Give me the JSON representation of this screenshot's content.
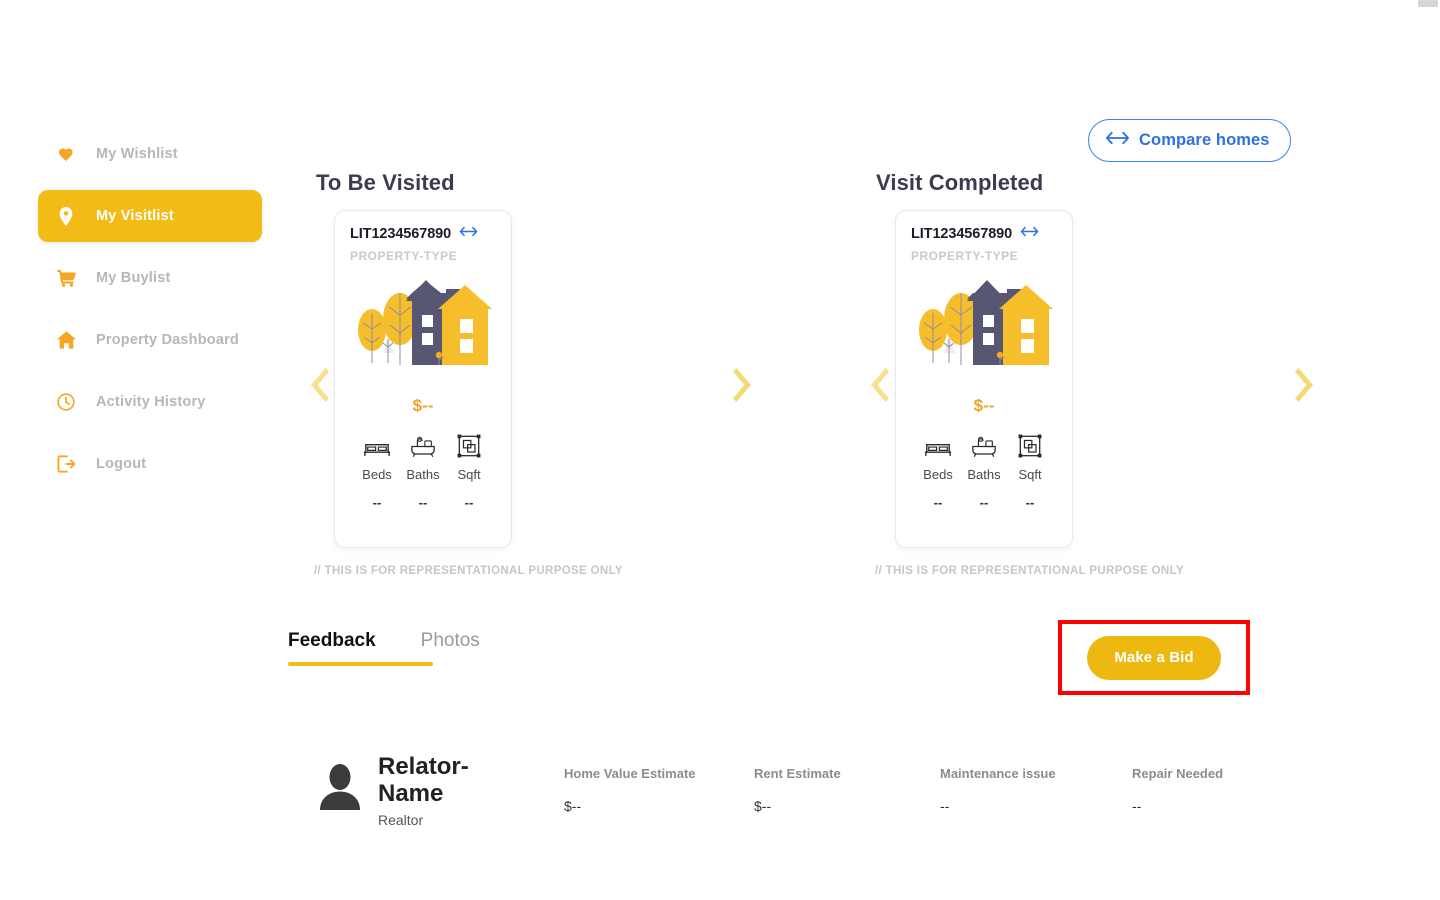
{
  "sidebar": {
    "items": [
      {
        "label": "My Wishlist",
        "icon": "heart-icon",
        "active": false
      },
      {
        "label": "My Visitlist",
        "icon": "location-pin-icon",
        "active": true
      },
      {
        "label": "My Buylist",
        "icon": "cart-icon",
        "active": false
      },
      {
        "label": "Property Dashboard",
        "icon": "home-icon",
        "active": false
      },
      {
        "label": "Activity History",
        "icon": "clock-icon",
        "active": false
      },
      {
        "label": "Logout",
        "icon": "logout-icon",
        "active": false
      }
    ]
  },
  "compare": {
    "label": "Compare homes",
    "icon": "left-right-arrow-icon",
    "color": "#2F6FE4"
  },
  "columns": {
    "left_heading": "To Be Visited",
    "right_heading": "Visit Completed"
  },
  "card": {
    "id": "LIT1234567890",
    "compare_icon": "left-right-arrow-icon",
    "property_type": "PROPERTY-TYPE",
    "price": "$--",
    "specs": [
      {
        "name": "Beds",
        "value": "--",
        "icon": "bed-icon"
      },
      {
        "name": "Baths",
        "value": "--",
        "icon": "bathtub-icon"
      },
      {
        "name": "Sqft",
        "value": "--",
        "icon": "area-icon"
      }
    ],
    "disclaimer": "// THIS IS FOR REPRESENTATIONAL PURPOSE ONLY"
  },
  "carousel": {
    "prev_icon": "chevron-left-icon",
    "next_icon": "chevron-right-icon"
  },
  "tabs": [
    {
      "label": "Feedback",
      "active": true
    },
    {
      "label": "Photos",
      "active": false
    }
  ],
  "bid": {
    "label": "Make a Bid",
    "button_color": "#EDB80F",
    "highlight_color": "#FF0000"
  },
  "realtor": {
    "name": "Relator-Name",
    "role": "Realtor",
    "avatar_icon": "person-avatar-icon",
    "stats": [
      {
        "label": "Home Value Estimate",
        "value": "$--"
      },
      {
        "label": "Rent Estimate",
        "value": "$--"
      },
      {
        "label": "Maintenance issue",
        "value": "--"
      },
      {
        "label": "Repair Needed",
        "value": "--"
      }
    ]
  },
  "theme": {
    "accent": "#F2BB15",
    "muted_text": "#b7b7b7",
    "price_color": "#F0A22C"
  }
}
